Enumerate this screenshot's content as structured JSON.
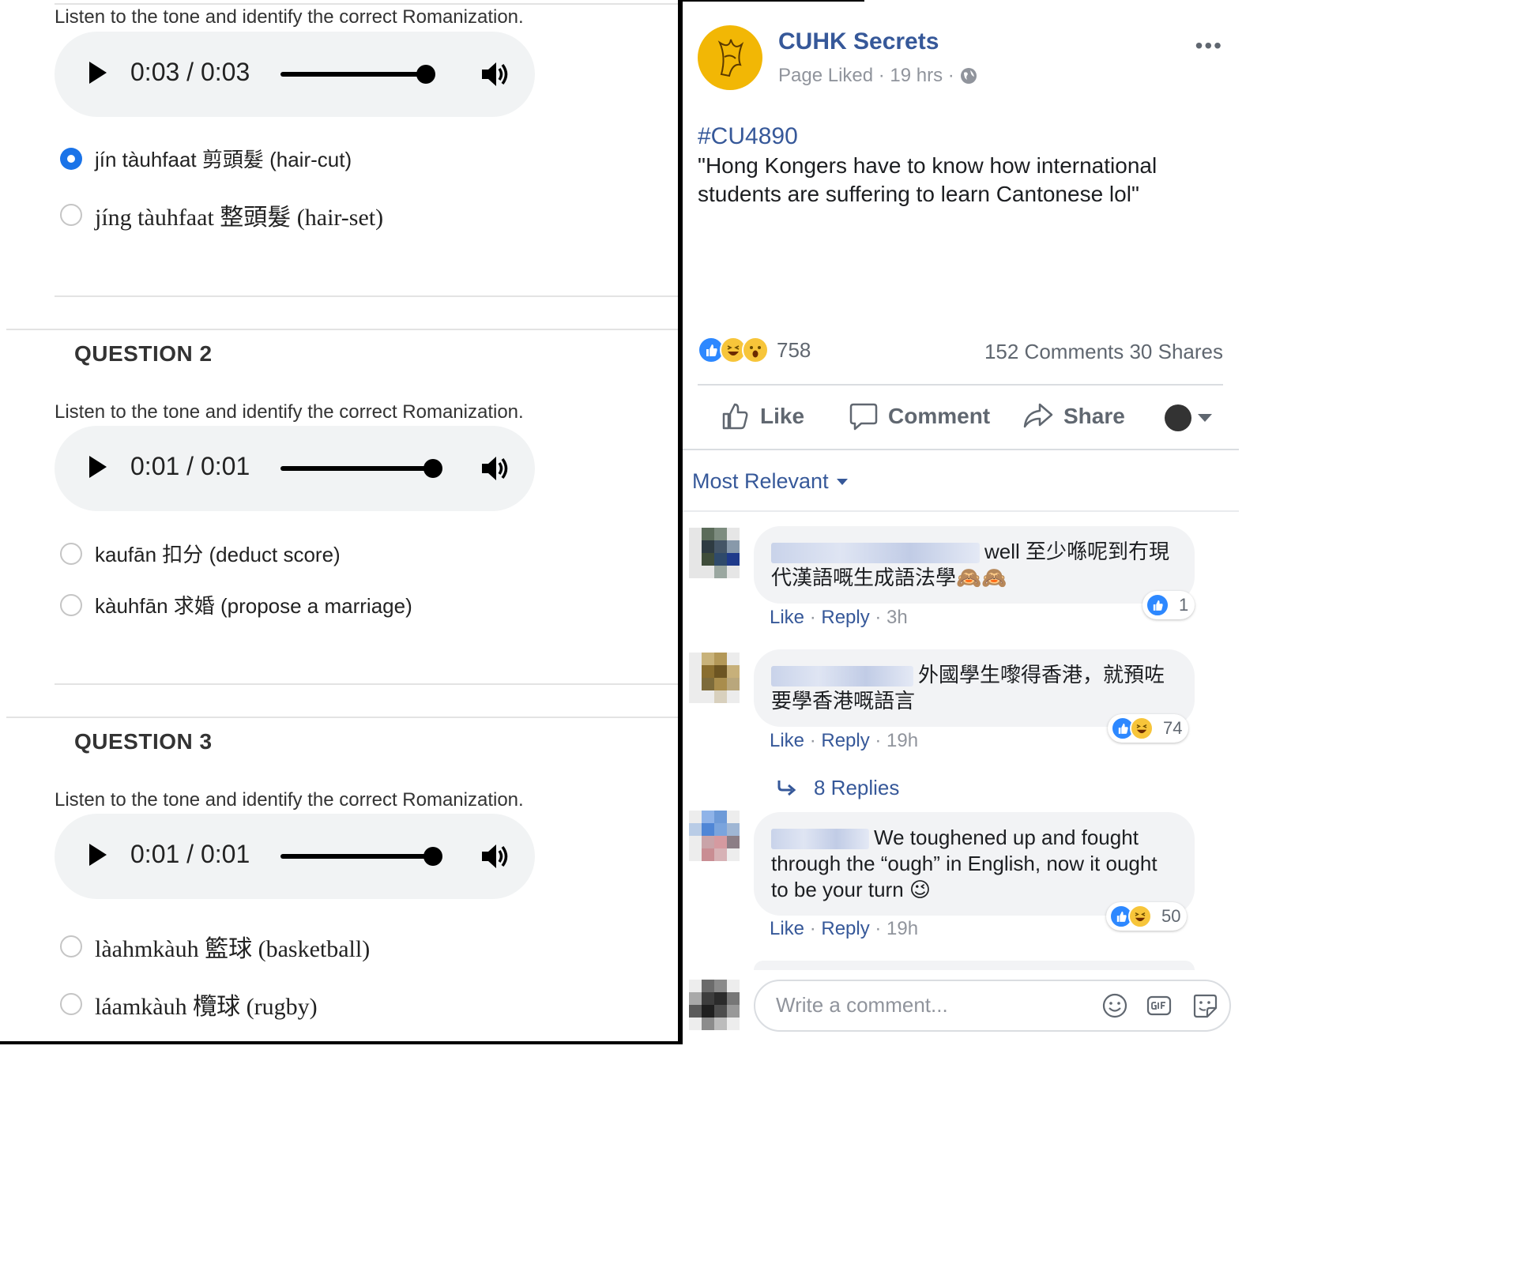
{
  "quiz": {
    "instruction": "Listen to the tone and identify the correct Romanization.",
    "q1": {
      "player_time": "0:03 / 0:03",
      "progress": 0.9,
      "options": [
        "jín tàuhfaat 剪頭髮 (hair-cut)",
        "jíng tàuhfaat 整頭髮 (hair-set)"
      ],
      "selected": 0
    },
    "q2": {
      "title": "QUESTION 2",
      "player_time": "0:01 / 0:01",
      "progress": 0.94,
      "options": [
        "kaufān 扣分 (deduct score)",
        "kàuhfān 求婚 (propose a marriage)"
      ]
    },
    "q3": {
      "title": "QUESTION 3",
      "player_time": "0:01 / 0:01",
      "progress": 0.94,
      "options": [
        "làahmkàuh 籃球 (basketball)",
        "láamkàuh 欖球 (rugby)"
      ]
    }
  },
  "post": {
    "page_name": "CUHK Secrets",
    "meta": "Page Liked · 19 hrs ·",
    "hashtag": "#CU4890",
    "text": "\"Hong Kongers have to know how international students are suffering to learn Cantonese lol\"",
    "reaction_count": "758",
    "comments_shares": "152 Comments  30 Shares",
    "actions": {
      "like": "Like",
      "comment": "Comment",
      "share": "Share"
    },
    "sort_label": "Most Relevant",
    "comments": [
      {
        "text": "well 至少喺呢到冇現代漢語嘅生成語法學🙈🙈",
        "reactions": "1",
        "like": "Like",
        "reply": "Reply",
        "time": "3h"
      },
      {
        "text": "外國學生嚟得香港，就預咗要學香港嘅語言",
        "reactions": "74",
        "like": "Like",
        "reply": "Reply",
        "time": "19h"
      },
      {
        "text": "We toughened up and fought through the “ough” in English, now it ought to be your turn 😉",
        "reactions": "50",
        "like": "Like",
        "reply": "Reply",
        "time": "19h"
      }
    ],
    "replies_link": "8 Replies",
    "composer_placeholder": "Write a comment...",
    "colors": {
      "link": "#365899",
      "like_blue": "#2d88ff",
      "page_avatar": "#f2b705"
    }
  }
}
